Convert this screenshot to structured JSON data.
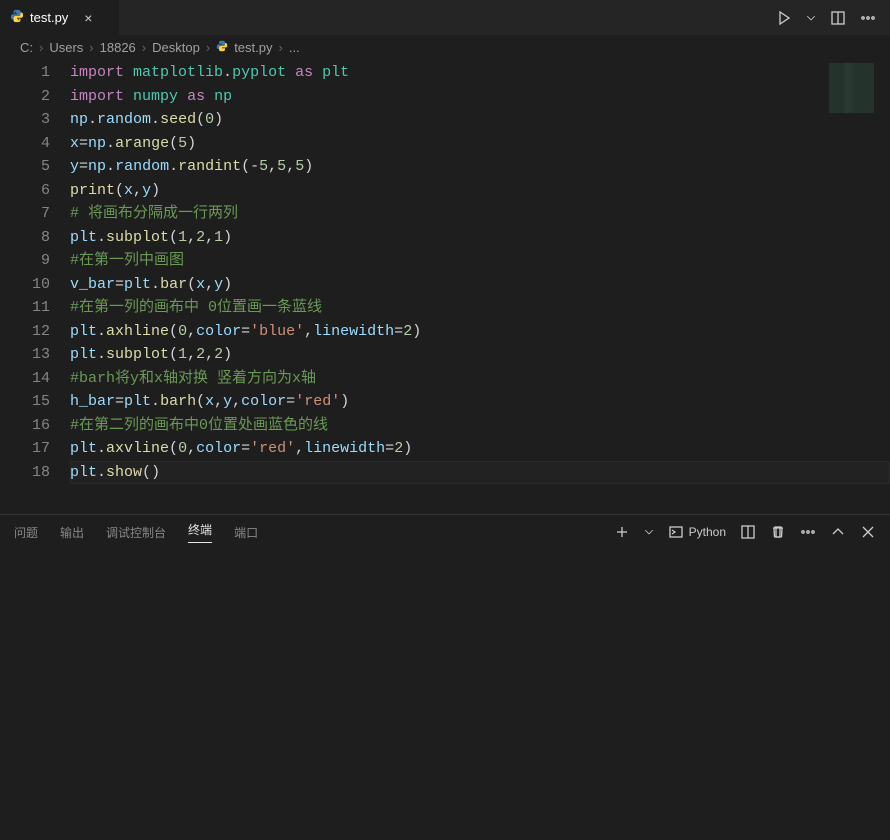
{
  "tab": {
    "filename": "test.py",
    "icon": "python-icon"
  },
  "breadcrumb": {
    "parts": [
      "C:",
      "Users",
      "18826",
      "Desktop"
    ],
    "file": "test.py",
    "tail": "..."
  },
  "editor": {
    "lines": [
      [
        {
          "t": "kw",
          "v": "import"
        },
        {
          "t": "op",
          "v": " "
        },
        {
          "t": "mod",
          "v": "matplotlib"
        },
        {
          "t": "pn",
          "v": "."
        },
        {
          "t": "mod",
          "v": "pyplot"
        },
        {
          "t": "op",
          "v": " "
        },
        {
          "t": "kw",
          "v": "as"
        },
        {
          "t": "op",
          "v": " "
        },
        {
          "t": "mod",
          "v": "plt"
        }
      ],
      [
        {
          "t": "kw",
          "v": "import"
        },
        {
          "t": "op",
          "v": " "
        },
        {
          "t": "mod",
          "v": "numpy"
        },
        {
          "t": "op",
          "v": " "
        },
        {
          "t": "kw",
          "v": "as"
        },
        {
          "t": "op",
          "v": " "
        },
        {
          "t": "mod",
          "v": "np"
        }
      ],
      [
        {
          "t": "var",
          "v": "np"
        },
        {
          "t": "pn",
          "v": "."
        },
        {
          "t": "var",
          "v": "random"
        },
        {
          "t": "pn",
          "v": "."
        },
        {
          "t": "fn",
          "v": "seed"
        },
        {
          "t": "pn",
          "v": "("
        },
        {
          "t": "num",
          "v": "0"
        },
        {
          "t": "pn",
          "v": ")"
        }
      ],
      [
        {
          "t": "var",
          "v": "x"
        },
        {
          "t": "op",
          "v": "="
        },
        {
          "t": "var",
          "v": "np"
        },
        {
          "t": "pn",
          "v": "."
        },
        {
          "t": "fn",
          "v": "arange"
        },
        {
          "t": "pn",
          "v": "("
        },
        {
          "t": "num",
          "v": "5"
        },
        {
          "t": "pn",
          "v": ")"
        }
      ],
      [
        {
          "t": "var",
          "v": "y"
        },
        {
          "t": "op",
          "v": "="
        },
        {
          "t": "var",
          "v": "np"
        },
        {
          "t": "pn",
          "v": "."
        },
        {
          "t": "var",
          "v": "random"
        },
        {
          "t": "pn",
          "v": "."
        },
        {
          "t": "fn",
          "v": "randint"
        },
        {
          "t": "pn",
          "v": "("
        },
        {
          "t": "op",
          "v": "-"
        },
        {
          "t": "num",
          "v": "5"
        },
        {
          "t": "pn",
          "v": ","
        },
        {
          "t": "num",
          "v": "5"
        },
        {
          "t": "pn",
          "v": ","
        },
        {
          "t": "num",
          "v": "5"
        },
        {
          "t": "pn",
          "v": ")"
        }
      ],
      [
        {
          "t": "fn",
          "v": "print"
        },
        {
          "t": "pn",
          "v": "("
        },
        {
          "t": "var",
          "v": "x"
        },
        {
          "t": "pn",
          "v": ","
        },
        {
          "t": "var",
          "v": "y"
        },
        {
          "t": "pn",
          "v": ")"
        }
      ],
      [
        {
          "t": "cmt",
          "v": "# 将画布分隔成一行两列"
        }
      ],
      [
        {
          "t": "var",
          "v": "plt"
        },
        {
          "t": "pn",
          "v": "."
        },
        {
          "t": "fn",
          "v": "subplot"
        },
        {
          "t": "pn",
          "v": "("
        },
        {
          "t": "num",
          "v": "1"
        },
        {
          "t": "pn",
          "v": ","
        },
        {
          "t": "num",
          "v": "2"
        },
        {
          "t": "pn",
          "v": ","
        },
        {
          "t": "num",
          "v": "1"
        },
        {
          "t": "pn",
          "v": ")"
        }
      ],
      [
        {
          "t": "cmt",
          "v": "#在第一列中画图"
        }
      ],
      [
        {
          "t": "var",
          "v": "v_bar"
        },
        {
          "t": "op",
          "v": "="
        },
        {
          "t": "var",
          "v": "plt"
        },
        {
          "t": "pn",
          "v": "."
        },
        {
          "t": "fn",
          "v": "bar"
        },
        {
          "t": "pn",
          "v": "("
        },
        {
          "t": "var",
          "v": "x"
        },
        {
          "t": "pn",
          "v": ","
        },
        {
          "t": "var",
          "v": "y"
        },
        {
          "t": "pn",
          "v": ")"
        }
      ],
      [
        {
          "t": "cmt",
          "v": "#在第一列的画布中 0位置画一条蓝线"
        }
      ],
      [
        {
          "t": "var",
          "v": "plt"
        },
        {
          "t": "pn",
          "v": "."
        },
        {
          "t": "fn",
          "v": "axhline"
        },
        {
          "t": "pn",
          "v": "("
        },
        {
          "t": "num",
          "v": "0"
        },
        {
          "t": "pn",
          "v": ","
        },
        {
          "t": "var",
          "v": "color"
        },
        {
          "t": "op",
          "v": "="
        },
        {
          "t": "str",
          "v": "'blue'"
        },
        {
          "t": "pn",
          "v": ","
        },
        {
          "t": "var",
          "v": "linewidth"
        },
        {
          "t": "op",
          "v": "="
        },
        {
          "t": "num",
          "v": "2"
        },
        {
          "t": "pn",
          "v": ")"
        }
      ],
      [
        {
          "t": "var",
          "v": "plt"
        },
        {
          "t": "pn",
          "v": "."
        },
        {
          "t": "fn",
          "v": "subplot"
        },
        {
          "t": "pn",
          "v": "("
        },
        {
          "t": "num",
          "v": "1"
        },
        {
          "t": "pn",
          "v": ","
        },
        {
          "t": "num",
          "v": "2"
        },
        {
          "t": "pn",
          "v": ","
        },
        {
          "t": "num",
          "v": "2"
        },
        {
          "t": "pn",
          "v": ")"
        }
      ],
      [
        {
          "t": "cmt",
          "v": "#barh将y和x轴对换 竖着方向为x轴"
        }
      ],
      [
        {
          "t": "var",
          "v": "h_bar"
        },
        {
          "t": "op",
          "v": "="
        },
        {
          "t": "var",
          "v": "plt"
        },
        {
          "t": "pn",
          "v": "."
        },
        {
          "t": "fn",
          "v": "barh"
        },
        {
          "t": "pn",
          "v": "("
        },
        {
          "t": "var",
          "v": "x"
        },
        {
          "t": "pn",
          "v": ","
        },
        {
          "t": "var",
          "v": "y"
        },
        {
          "t": "pn",
          "v": ","
        },
        {
          "t": "var",
          "v": "color"
        },
        {
          "t": "op",
          "v": "="
        },
        {
          "t": "str",
          "v": "'red'"
        },
        {
          "t": "pn",
          "v": ")"
        }
      ],
      [
        {
          "t": "cmt",
          "v": "#在第二列的画布中0位置处画蓝色的线"
        }
      ],
      [
        {
          "t": "var",
          "v": "plt"
        },
        {
          "t": "pn",
          "v": "."
        },
        {
          "t": "fn",
          "v": "axvline"
        },
        {
          "t": "pn",
          "v": "("
        },
        {
          "t": "num",
          "v": "0"
        },
        {
          "t": "pn",
          "v": ","
        },
        {
          "t": "var",
          "v": "color"
        },
        {
          "t": "op",
          "v": "="
        },
        {
          "t": "str",
          "v": "'red'"
        },
        {
          "t": "pn",
          "v": ","
        },
        {
          "t": "var",
          "v": "linewidth"
        },
        {
          "t": "op",
          "v": "="
        },
        {
          "t": "num",
          "v": "2"
        },
        {
          "t": "pn",
          "v": ")"
        }
      ],
      [
        {
          "t": "var",
          "v": "plt"
        },
        {
          "t": "pn",
          "v": "."
        },
        {
          "t": "fn",
          "v": "show"
        },
        {
          "t": "pn",
          "v": "("
        },
        {
          "t": "pn",
          "v": ")"
        }
      ]
    ],
    "current_line_index": 17
  },
  "panel": {
    "tabs": [
      "问题",
      "输出",
      "调试控制台",
      "终端",
      "端口"
    ],
    "active_index": 3,
    "launch_profile": "Python"
  }
}
